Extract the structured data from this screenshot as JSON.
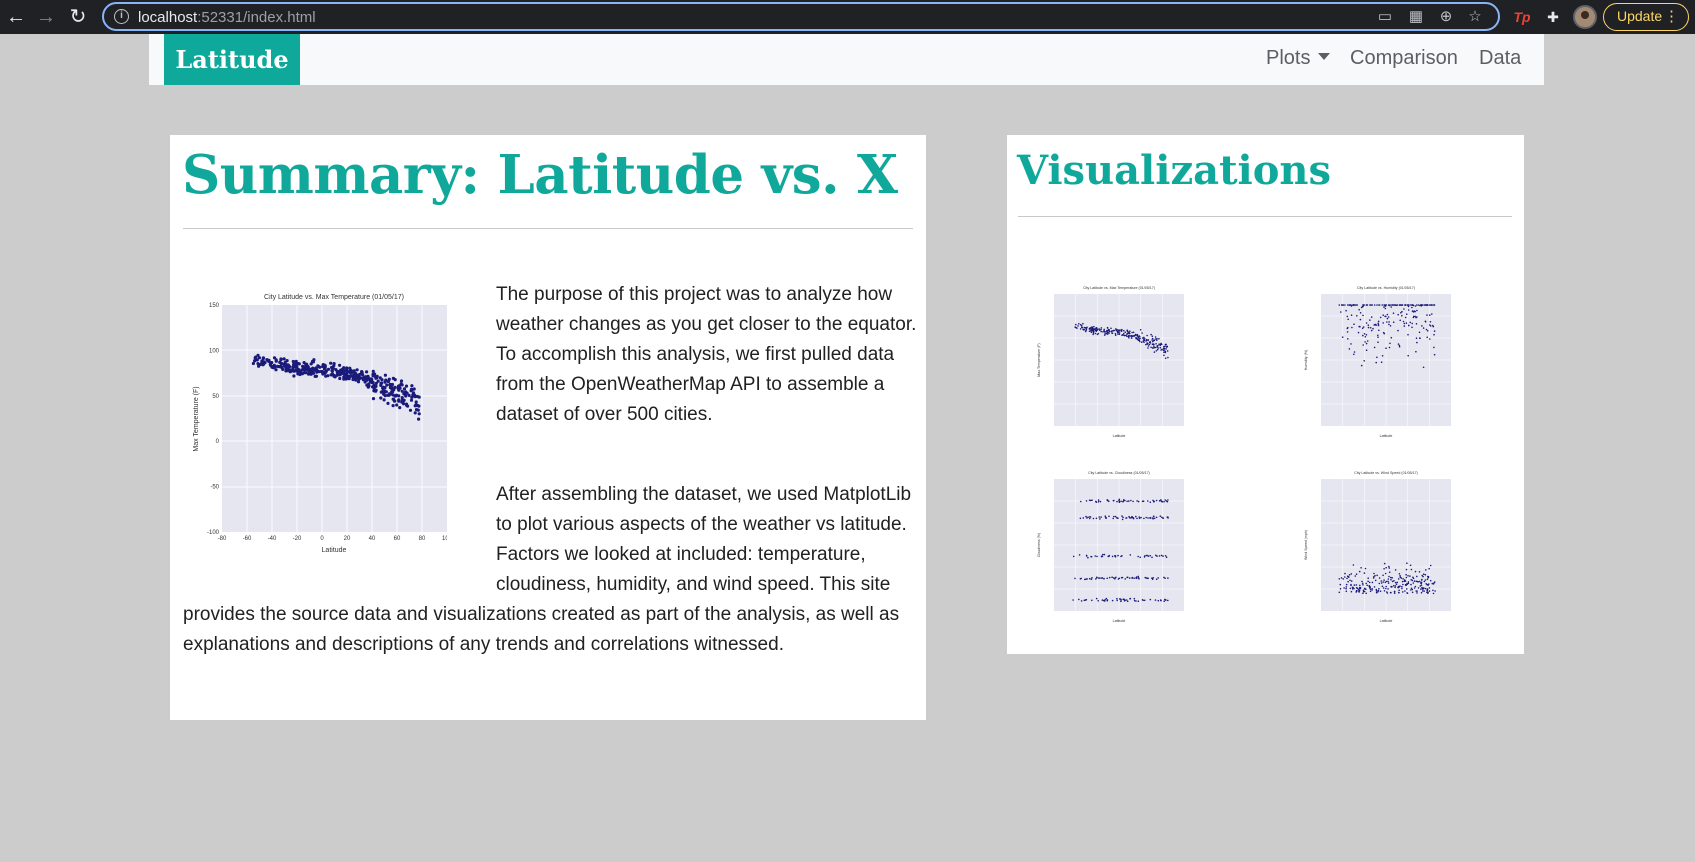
{
  "browser": {
    "url_host": "localhost",
    "url_rest": ":52331/index.html",
    "update_label": "Update"
  },
  "navbar": {
    "brand": "Latitude",
    "links": [
      {
        "label": "Plots",
        "dropdown": true
      },
      {
        "label": "Comparison"
      },
      {
        "label": "Data"
      }
    ]
  },
  "summary": {
    "title": "Summary: Latitude vs. X",
    "paragraphs": [
      "The purpose of this project was to analyze how weather changes as you get closer to the equator. To accomplish this analysis, we first pulled data from the OpenWeatherMap API to assemble a dataset of over 500 cities.",
      "After assembling the dataset, we used MatplotLib to plot various aspects of the weather vs latitude. Factors we looked at included: temperature, cloudiness, humidity, and wind speed. This site provides the source data and visualizations created as part of the analysis, as well as explanations and descriptions of any trends and correlations witnessed."
    ],
    "main_plot": {
      "title": "City Latitude vs. Max Temperature (01/05/17)",
      "xlabel": "Latitude",
      "ylabel": "Max Temperature (F)",
      "xticks": [
        "-80",
        "-60",
        "-40",
        "-20",
        "0",
        "20",
        "40",
        "60",
        "80",
        "100"
      ],
      "yticks": [
        "150",
        "100",
        "50",
        "0",
        "-50",
        "-100"
      ]
    }
  },
  "visualizations": {
    "title": "Visualizations",
    "thumbnails": [
      {
        "title": "City Latitude vs. Max Temperature (01/05/17)",
        "xlabel": "Latitude",
        "ylabel": "Max Temperature (F)"
      },
      {
        "title": "City Latitude vs. Humidity (01/05/17)",
        "xlabel": "Latitude",
        "ylabel": "Humidity (%)"
      },
      {
        "title": "City Latitude vs. Cloudiness (01/05/17)",
        "xlabel": "Latitude",
        "ylabel": "Cloudiness (%)"
      },
      {
        "title": "City Latitude vs. Wind Speed (01/05/17)",
        "xlabel": "Latitude",
        "ylabel": "Wind Speed (mph)"
      }
    ]
  },
  "colors": {
    "brand": "#0fa99c",
    "heading": "#10a89a",
    "page_bg": "#cccccc",
    "point": "#1a1a7a",
    "plot_bg": "#e6e6f0"
  }
}
